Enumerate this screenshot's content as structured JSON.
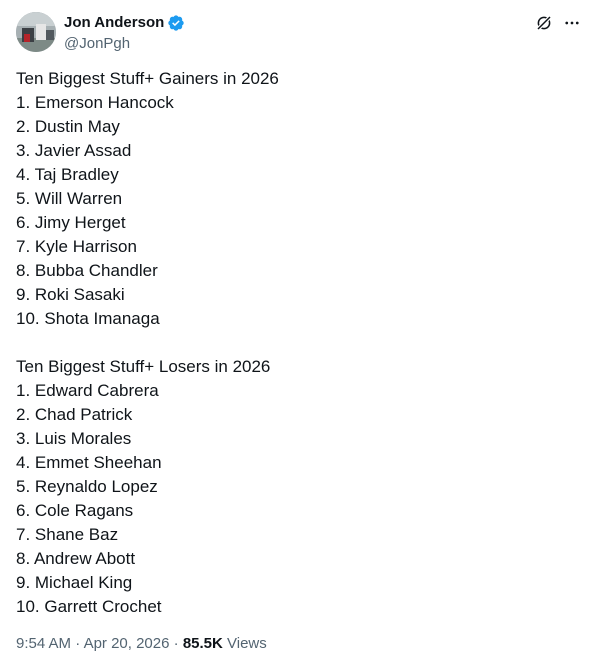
{
  "author": {
    "name": "Jon Anderson",
    "handle": "@JonPgh",
    "verified": true,
    "avatar_icon": "profile-photo",
    "verified_icon": "verified-badge-icon"
  },
  "actions": {
    "grok_icon": "grok-icon",
    "more_icon": "more-options-icon"
  },
  "tweet": {
    "gainers_title": "Ten Biggest Stuff+ Gainers in 2026",
    "gainers": [
      "1. Emerson Hancock",
      "2. Dustin May",
      "3. Javier Assad",
      "4. Taj Bradley",
      "5. Will Warren",
      "6. Jimy Herget",
      "7. Kyle Harrison",
      "8. Bubba Chandler",
      "9. Roki Sasaki",
      "10. Shota Imanaga"
    ],
    "losers_title": "Ten Biggest Stuff+ Losers in 2026",
    "losers": [
      "1. Edward Cabrera",
      "2. Chad Patrick",
      "3. Luis Morales",
      "4. Emmet Sheehan",
      "5. Reynaldo Lopez",
      "6. Cole Ragans",
      "7. Shane Baz",
      "8. Andrew Abott",
      "9. Michael King",
      "10. Garrett Crochet"
    ]
  },
  "meta": {
    "time": "9:54 AM",
    "separator": "·",
    "date": "Apr 20, 2026",
    "views_count": "85.5K",
    "views_label": "Views"
  },
  "colors": {
    "text": "#0f1419",
    "secondary": "#536471",
    "verified": "#1d9bf0"
  }
}
